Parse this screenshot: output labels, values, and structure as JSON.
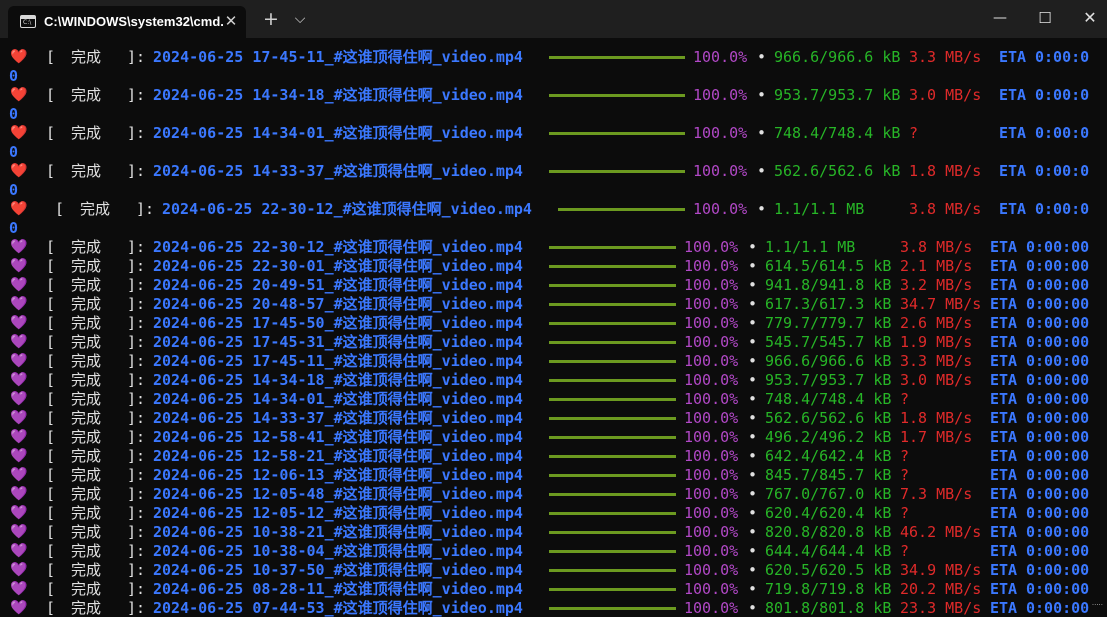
{
  "window": {
    "tab_title": "C:\\WINDOWS\\system32\\cmd.",
    "tab_icon": "cmd-icon",
    "close_glyph": "✕",
    "new_tab_glyph": "+",
    "dropdown_glyph": "⌵",
    "minimize_glyph": "—",
    "maximize_glyph": "☐",
    "window_close_glyph": "✕"
  },
  "colors": {
    "background": "#0c0c0c",
    "filename": "#3b78ff",
    "progress_bar": "#6c9a20",
    "percent": "#b148c6",
    "size": "#27b627",
    "speed": "#e02a2a",
    "eta": "#3b78ff"
  },
  "labels": {
    "status": "完成",
    "eta_prefix": "ETA",
    "wrap_char": "0"
  },
  "red_rows": [
    {
      "heart": "❤️",
      "file": "2024-06-25 17-45-11_#这谁顶得住啊_video.mp4",
      "pct": "100.0%",
      "size": "966.6/966.6 kB",
      "speed": "3.3 MB/s",
      "eta": "0:00:0"
    },
    {
      "heart": "❤️",
      "file": "2024-06-25 14-34-18_#这谁顶得住啊_video.mp4",
      "pct": "100.0%",
      "size": "953.7/953.7 kB",
      "speed": "3.0 MB/s",
      "eta": "0:00:0"
    },
    {
      "heart": "❤️",
      "file": "2024-06-25 14-34-01_#这谁顶得住啊_video.mp4",
      "pct": "100.0%",
      "size": "748.4/748.4 kB",
      "speed": "?",
      "eta": "0:00:0"
    },
    {
      "heart": "❤️",
      "file": "2024-06-25 14-33-37_#这谁顶得住啊_video.mp4",
      "pct": "100.0%",
      "size": "562.6/562.6 kB",
      "speed": "1.8 MB/s",
      "eta": "0:00:0"
    },
    {
      "heart": "❤️",
      "file": "2024-06-25 22-30-12_#这谁顶得住啊_video.mp4",
      "pct": "100.0%",
      "size": "1.1/1.1 MB",
      "speed": "3.8 MB/s",
      "eta": "0:00:0"
    }
  ],
  "purple_rows": [
    {
      "heart": "💜",
      "file": "2024-06-25 22-30-12_#这谁顶得住啊_video.mp4",
      "pct": "100.0%",
      "size": "1.1/1.1 MB",
      "speed": "3.8 MB/s",
      "eta": "0:00:00"
    },
    {
      "heart": "💜",
      "file": "2024-06-25 22-30-01_#这谁顶得住啊_video.mp4",
      "pct": "100.0%",
      "size": "614.5/614.5 kB",
      "speed": "2.1 MB/s",
      "eta": "0:00:00"
    },
    {
      "heart": "💜",
      "file": "2024-06-25 20-49-51_#这谁顶得住啊_video.mp4",
      "pct": "100.0%",
      "size": "941.8/941.8 kB",
      "speed": "3.2 MB/s",
      "eta": "0:00:00"
    },
    {
      "heart": "💜",
      "file": "2024-06-25 20-48-57_#这谁顶得住啊_video.mp4",
      "pct": "100.0%",
      "size": "617.3/617.3 kB",
      "speed": "34.7 MB/s",
      "eta": "0:00:00"
    },
    {
      "heart": "💜",
      "file": "2024-06-25 17-45-50_#这谁顶得住啊_video.mp4",
      "pct": "100.0%",
      "size": "779.7/779.7 kB",
      "speed": "2.6 MB/s",
      "eta": "0:00:00"
    },
    {
      "heart": "💜",
      "file": "2024-06-25 17-45-31_#这谁顶得住啊_video.mp4",
      "pct": "100.0%",
      "size": "545.7/545.7 kB",
      "speed": "1.9 MB/s",
      "eta": "0:00:00"
    },
    {
      "heart": "💜",
      "file": "2024-06-25 17-45-11_#这谁顶得住啊_video.mp4",
      "pct": "100.0%",
      "size": "966.6/966.6 kB",
      "speed": "3.3 MB/s",
      "eta": "0:00:00"
    },
    {
      "heart": "💜",
      "file": "2024-06-25 14-34-18_#这谁顶得住啊_video.mp4",
      "pct": "100.0%",
      "size": "953.7/953.7 kB",
      "speed": "3.0 MB/s",
      "eta": "0:00:00"
    },
    {
      "heart": "💜",
      "file": "2024-06-25 14-34-01_#这谁顶得住啊_video.mp4",
      "pct": "100.0%",
      "size": "748.4/748.4 kB",
      "speed": "?",
      "eta": "0:00:00"
    },
    {
      "heart": "💜",
      "file": "2024-06-25 14-33-37_#这谁顶得住啊_video.mp4",
      "pct": "100.0%",
      "size": "562.6/562.6 kB",
      "speed": "1.8 MB/s",
      "eta": "0:00:00"
    },
    {
      "heart": "💜",
      "file": "2024-06-25 12-58-41_#这谁顶得住啊_video.mp4",
      "pct": "100.0%",
      "size": "496.2/496.2 kB",
      "speed": "1.7 MB/s",
      "eta": "0:00:00"
    },
    {
      "heart": "💜",
      "file": "2024-06-25 12-58-21_#这谁顶得住啊_video.mp4",
      "pct": "100.0%",
      "size": "642.4/642.4 kB",
      "speed": "?",
      "eta": "0:00:00"
    },
    {
      "heart": "💜",
      "file": "2024-06-25 12-06-13_#这谁顶得住啊_video.mp4",
      "pct": "100.0%",
      "size": "845.7/845.7 kB",
      "speed": "?",
      "eta": "0:00:00"
    },
    {
      "heart": "💜",
      "file": "2024-06-25 12-05-48_#这谁顶得住啊_video.mp4",
      "pct": "100.0%",
      "size": "767.0/767.0 kB",
      "speed": "7.3 MB/s",
      "eta": "0:00:00"
    },
    {
      "heart": "💜",
      "file": "2024-06-25 12-05-12_#这谁顶得住啊_video.mp4",
      "pct": "100.0%",
      "size": "620.4/620.4 kB",
      "speed": "?",
      "eta": "0:00:00"
    },
    {
      "heart": "💜",
      "file": "2024-06-25 10-38-21_#这谁顶得住啊_video.mp4",
      "pct": "100.0%",
      "size": "820.8/820.8 kB",
      "speed": "46.2 MB/s",
      "eta": "0:00:00"
    },
    {
      "heart": "💜",
      "file": "2024-06-25 10-38-04_#这谁顶得住啊_video.mp4",
      "pct": "100.0%",
      "size": "644.4/644.4 kB",
      "speed": "?",
      "eta": "0:00:00"
    },
    {
      "heart": "💜",
      "file": "2024-06-25 10-37-50_#这谁顶得住啊_video.mp4",
      "pct": "100.0%",
      "size": "620.5/620.5 kB",
      "speed": "34.9 MB/s",
      "eta": "0:00:00"
    },
    {
      "heart": "💜",
      "file": "2024-06-25 08-28-11_#这谁顶得住啊_video.mp4",
      "pct": "100.0%",
      "size": "719.8/719.8 kB",
      "speed": "20.2 MB/s",
      "eta": "0:00:00"
    },
    {
      "heart": "💜",
      "file": "2024-06-25 07-44-53_#这谁顶得住啊_video.mp4",
      "pct": "100.0%",
      "size": "801.8/801.8 kB",
      "speed": "23.3 MB/s",
      "eta": "0:00:00"
    }
  ]
}
